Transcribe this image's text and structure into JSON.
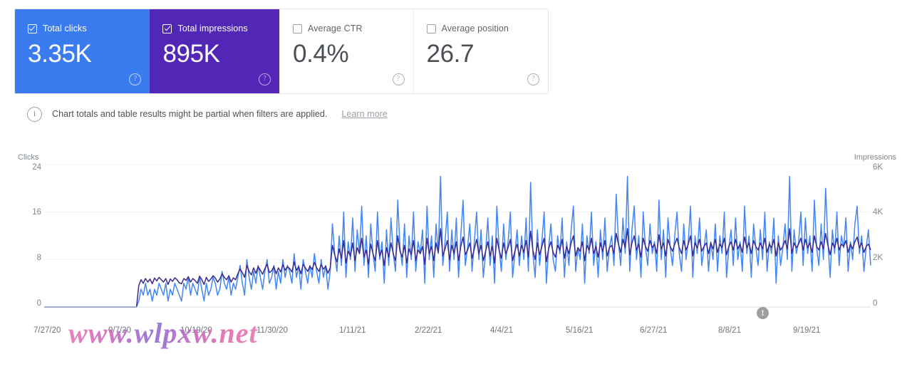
{
  "cards": [
    {
      "id": "total-clicks",
      "label": "Total clicks",
      "value": "3.35K",
      "checked": true,
      "help": "?"
    },
    {
      "id": "total-impressions",
      "label": "Total impressions",
      "value": "895K",
      "checked": true,
      "help": "?"
    },
    {
      "id": "average-ctr",
      "label": "Average CTR",
      "value": "0.4%",
      "checked": false,
      "help": "?"
    },
    {
      "id": "average-position",
      "label": "Average position",
      "value": "26.7",
      "checked": false,
      "help": "?"
    }
  ],
  "banner": {
    "icon": "info-icon",
    "text": "Chart totals and table results might be partial when filters are applied.",
    "link": "Learn more"
  },
  "annotation": {
    "icon": "alert-icon",
    "glyph": "!"
  },
  "watermark": "www.wlpxw.net",
  "chart_data": {
    "type": "line",
    "title": "",
    "xlabel": "",
    "ylabel": "Clicks",
    "y2label": "Impressions",
    "grid": true,
    "legend": "none",
    "ylim": [
      0,
      24
    ],
    "y2lim": [
      0,
      6000
    ],
    "yticks": [
      "0",
      "8",
      "16",
      "24"
    ],
    "y2ticks": [
      "0",
      "2K",
      "4K",
      "6K"
    ],
    "xticks": [
      "7/27/20",
      "9/7/20",
      "10/19/20",
      "11/30/20",
      "1/11/21",
      "2/22/21",
      "4/4/21",
      "5/16/21",
      "6/27/21",
      "8/8/21",
      "9/19/21"
    ],
    "colors": {
      "clicks": "#4285f4",
      "impressions": "#3b2a8c"
    },
    "series": [
      {
        "name": "Clicks",
        "axis": "left",
        "color": "#4285f4",
        "values": [
          0,
          0,
          0,
          0,
          0,
          0,
          0,
          0,
          0,
          0,
          0,
          0,
          0,
          0,
          0,
          0,
          0,
          0,
          0,
          0,
          0,
          0,
          0,
          0,
          0,
          0,
          0,
          0,
          0,
          0,
          0,
          0,
          0,
          0,
          0,
          0,
          0,
          0,
          0,
          0,
          0,
          0,
          1,
          3,
          2,
          4,
          2,
          3,
          1,
          3,
          2,
          4,
          3,
          2,
          4,
          1,
          3,
          2,
          4,
          3,
          2,
          1,
          4,
          3,
          5,
          2,
          4,
          3,
          2,
          5,
          3,
          1,
          4,
          2,
          3,
          5,
          4,
          2,
          3,
          6,
          4,
          3,
          5,
          2,
          4,
          3,
          5,
          7,
          4,
          2,
          8,
          5,
          3,
          6,
          4,
          7,
          5,
          3,
          6,
          8,
          4,
          5,
          7,
          3,
          6,
          4,
          8,
          5,
          7,
          6,
          4,
          9,
          5,
          7,
          3,
          8,
          6,
          4,
          7,
          5,
          9,
          6,
          4,
          8,
          5,
          7,
          3,
          6,
          14,
          9,
          6,
          12,
          7,
          16,
          5,
          11,
          8,
          15,
          6,
          13,
          9,
          17,
          7,
          12,
          5,
          14,
          9,
          6,
          16,
          8,
          11,
          4,
          13,
          7,
          15,
          9,
          6,
          18,
          10,
          7,
          14,
          5,
          12,
          8,
          16,
          6,
          11,
          9,
          13,
          4,
          17,
          8,
          12,
          5,
          14,
          9,
          22,
          7,
          11,
          16,
          6,
          13,
          8,
          15,
          5,
          12,
          18,
          7,
          10,
          14,
          6,
          11,
          16,
          8,
          13,
          5,
          9,
          15,
          7,
          12,
          4,
          17,
          10,
          6,
          14,
          8,
          11,
          16,
          5,
          9,
          13,
          7,
          12,
          8,
          15,
          6,
          21,
          9,
          5,
          13,
          7,
          11,
          16,
          4,
          10,
          14,
          8,
          6,
          12,
          9,
          15,
          5,
          11,
          7,
          13,
          17,
          6,
          10,
          8,
          14,
          4,
          12,
          9,
          16,
          7,
          11,
          5,
          13,
          8,
          15,
          6,
          10,
          12,
          7,
          19,
          11,
          7,
          15,
          9,
          22,
          6,
          13,
          17,
          8,
          12,
          5,
          16,
          10,
          7,
          14,
          9,
          11,
          6,
          18,
          8,
          13,
          5,
          15,
          10,
          7,
          12,
          16,
          9,
          6,
          14,
          8,
          11,
          17,
          5,
          12,
          9,
          15,
          7,
          10,
          13,
          6,
          11,
          8,
          14,
          6,
          12,
          9,
          16,
          5,
          10,
          13,
          7,
          15,
          8,
          11,
          6,
          17,
          9,
          12,
          5,
          14,
          10,
          7,
          13,
          8,
          16,
          6,
          11,
          9,
          15,
          4,
          12,
          7,
          10,
          14,
          8,
          22,
          6,
          13,
          9,
          11,
          16,
          7,
          15,
          9,
          12,
          6,
          18,
          10,
          7,
          14,
          8,
          20,
          11,
          5,
          13,
          9,
          16,
          7,
          12,
          10,
          15,
          6,
          11,
          8,
          14,
          17,
          9,
          12,
          6,
          10,
          13,
          7
        ]
      },
      {
        "name": "Impressions",
        "axis": "right",
        "color": "#3b2a8c",
        "values": [
          0,
          0,
          0,
          0,
          0,
          0,
          0,
          0,
          0,
          0,
          0,
          0,
          0,
          0,
          0,
          0,
          0,
          0,
          0,
          0,
          0,
          0,
          0,
          0,
          0,
          0,
          0,
          0,
          0,
          0,
          0,
          0,
          0,
          0,
          0,
          0,
          0,
          0,
          0,
          0,
          0,
          0,
          900,
          1150,
          1000,
          1200,
          1050,
          1180,
          980,
          1220,
          1100,
          1250,
          1150,
          1050,
          1200,
          950,
          1180,
          1080,
          1230,
          1150,
          1020,
          980,
          1200,
          1120,
          1280,
          1050,
          1200,
          1120,
          1000,
          1300,
          1150,
          950,
          1250,
          1080,
          1180,
          1320,
          1220,
          1050,
          1180,
          1400,
          1250,
          1150,
          1320,
          1050,
          1230,
          1150,
          1400,
          1600,
          1450,
          1250,
          1750,
          1500,
          1350,
          1650,
          1420,
          1700,
          1550,
          1380,
          1620,
          1800,
          1450,
          1520,
          1700,
          1400,
          1650,
          1480,
          1780,
          1550,
          1700,
          1620,
          1480,
          1900,
          1550,
          1700,
          1400,
          1800,
          1650,
          1500,
          1720,
          1580,
          1880,
          1650,
          1500,
          1780,
          1600,
          1720,
          1420,
          1650,
          2600,
          2200,
          1900,
          2450,
          2050,
          2800,
          1850,
          2350,
          2150,
          2700,
          1950,
          2500,
          2250,
          2900,
          2100,
          2400,
          1800,
          2650,
          2250,
          1950,
          2800,
          2150,
          2400,
          1750,
          2500,
          2100,
          2700,
          2250,
          1950,
          3000,
          2350,
          2100,
          2600,
          1850,
          2450,
          2200,
          2800,
          1950,
          2400,
          2250,
          2550,
          1800,
          2900,
          2250,
          2550,
          1950,
          2700,
          2300,
          3300,
          2150,
          2450,
          2800,
          2000,
          2600,
          2250,
          2750,
          1950,
          2550,
          2950,
          2200,
          2400,
          2700,
          2050,
          2450,
          2850,
          2250,
          2600,
          1950,
          2350,
          2750,
          2150,
          2550,
          1850,
          2900,
          2400,
          2050,
          2700,
          2250,
          2500,
          2850,
          1950,
          2350,
          2650,
          2150,
          2600,
          2300,
          2800,
          2100,
          3200,
          2400,
          2000,
          2700,
          2200,
          2550,
          2900,
          1900,
          2450,
          2750,
          2300,
          2100,
          2600,
          2400,
          2850,
          2050,
          2550,
          2250,
          2700,
          3000,
          2150,
          2500,
          2350,
          2750,
          1950,
          2600,
          2400,
          2900,
          2250,
          2550,
          2100,
          2700,
          2350,
          2800,
          2150,
          2500,
          2600,
          2250,
          3100,
          2650,
          2300,
          2850,
          2500,
          3300,
          2200,
          2700,
          3000,
          2400,
          2650,
          2100,
          2900,
          2550,
          2350,
          2800,
          2500,
          2650,
          2250,
          3050,
          2450,
          2700,
          2150,
          2850,
          2550,
          2350,
          2650,
          2900,
          2500,
          2250,
          2800,
          2400,
          2650,
          3000,
          2150,
          2700,
          2500,
          2850,
          2350,
          2550,
          2700,
          2250,
          2700,
          2450,
          2850,
          2300,
          2650,
          2500,
          2900,
          2200,
          2550,
          2750,
          2400,
          2850,
          2450,
          2650,
          2300,
          2950,
          2500,
          2700,
          2250,
          2800,
          2550,
          2400,
          2700,
          2450,
          2900,
          2300,
          2650,
          2500,
          2850,
          2150,
          2700,
          2400,
          2550,
          2800,
          2450,
          3300,
          2250,
          2700,
          2500,
          2650,
          2900,
          2400,
          2850,
          2500,
          2700,
          2300,
          3000,
          2550,
          2400,
          2750,
          2450,
          3100,
          2600,
          2200,
          2700,
          2500,
          2900,
          2400,
          2650,
          2550,
          2800,
          2300,
          2650,
          2450,
          2750,
          2950,
          2500,
          2700,
          2300,
          2550,
          2650,
          2400
        ]
      }
    ]
  }
}
